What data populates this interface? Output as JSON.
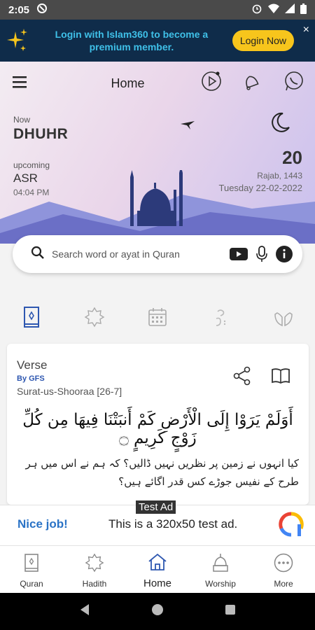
{
  "status_bar": {
    "time": "2:05"
  },
  "promo": {
    "text": "Login with Islam360 to become a premium member.",
    "button": "Login Now",
    "close": "×"
  },
  "header": {
    "title": "Home",
    "now_label": "Now",
    "now_prayer": "DHUHR",
    "upcoming_label": "upcoming",
    "upcoming_prayer": "ASR",
    "upcoming_time": "04:04 PM",
    "hijri_day": "20",
    "hijri_month": "Rajab, 1443",
    "gregorian": "Tuesday 22-02-2022"
  },
  "search": {
    "placeholder": "Search word or ayat in Quran"
  },
  "verse": {
    "title": "Verse",
    "by": "By GFS",
    "surah": "Surat-us-Shooraa [26-7]",
    "arabic": "أَوَلَمْ يَرَوْا إِلَى الْأَرْضِ كَمْ أَنبَتْنَا فِيهَا مِن كُلِّ زَوْجٍ كَرِيمٍ ۝",
    "urdu": "کیا انہوں نے زمین پر نظریں نہیں ڈالیں؟ کہ ہم نے اس میں ہر طرح کے نفیس جوڑے کس قدر اگائے ہیں؟"
  },
  "ad": {
    "label": "Test Ad",
    "nice": "Nice job!",
    "text": "This is a 320x50 test ad."
  },
  "bottom_nav": [
    {
      "label": "Quran"
    },
    {
      "label": "Hadith"
    },
    {
      "label": "Home"
    },
    {
      "label": "Worship"
    },
    {
      "label": "More"
    }
  ],
  "colors": {
    "accent_blue": "#2e57b0",
    "promo_bg": "#0f2c4a",
    "login_button": "#f7c51c"
  }
}
